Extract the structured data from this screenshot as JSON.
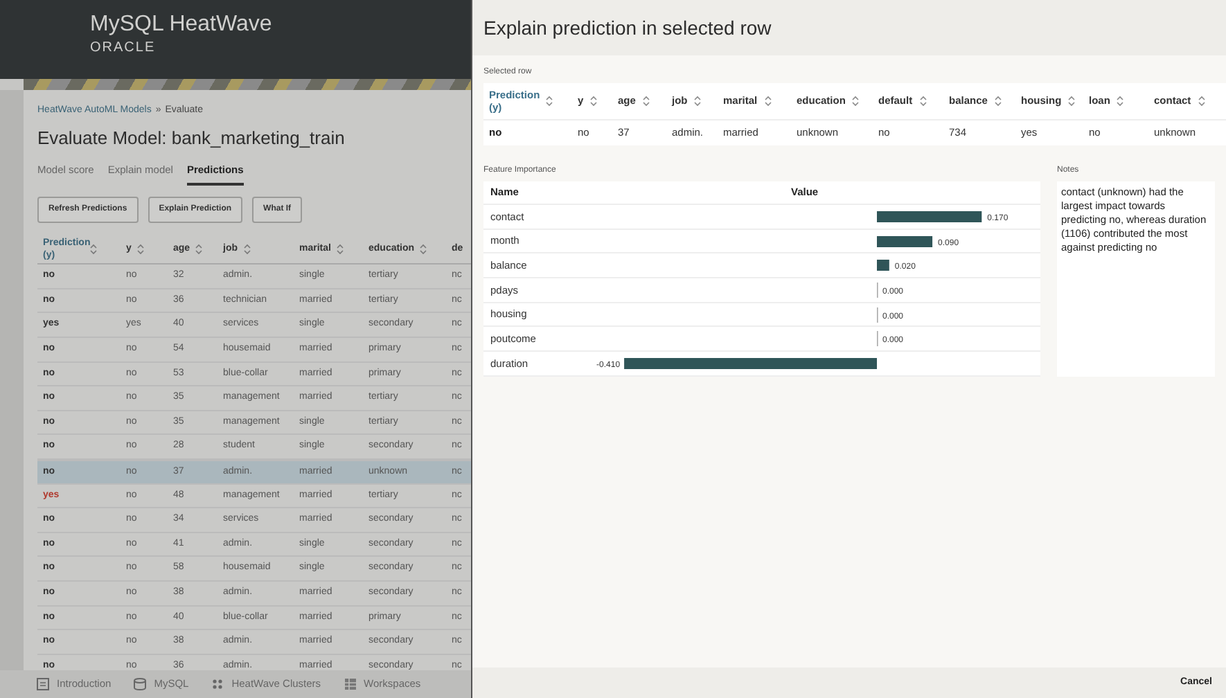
{
  "app": {
    "title": "MySQL HeatWave",
    "brand": "ORACLE"
  },
  "page": {
    "breadcrumb": [
      {
        "label": "HeatWave AutoML Models"
      },
      {
        "label": "Evaluate"
      }
    ],
    "breadcrumb_separator": "»",
    "title": "Evaluate Model: bank_marketing_train",
    "tabs": [
      {
        "label": "Model score",
        "selected": false
      },
      {
        "label": "Explain model",
        "selected": false
      },
      {
        "label": "Predictions",
        "selected": true
      }
    ],
    "buttons": [
      "Refresh Predictions",
      "Explain Prediction",
      "What If"
    ],
    "table": {
      "columns": [
        {
          "label": "Prediction (y)",
          "sortable": true
        },
        {
          "label": "y",
          "sortable": true
        },
        {
          "label": "age",
          "sortable": true
        },
        {
          "label": "job",
          "sortable": true
        },
        {
          "label": "marital",
          "sortable": true
        },
        {
          "label": "education",
          "sortable": true
        },
        {
          "label": "de",
          "sortable": false
        }
      ],
      "rows": [
        {
          "cells": [
            "no",
            "no",
            "32",
            "admin.",
            "single",
            "tertiary",
            "nc"
          ],
          "selected": false,
          "mismatch": false
        },
        {
          "cells": [
            "no",
            "no",
            "36",
            "technician",
            "married",
            "tertiary",
            "nc"
          ],
          "selected": false,
          "mismatch": false
        },
        {
          "cells": [
            "yes",
            "yes",
            "40",
            "services",
            "single",
            "secondary",
            "nc"
          ],
          "selected": false,
          "mismatch": false
        },
        {
          "cells": [
            "no",
            "no",
            "54",
            "housemaid",
            "married",
            "primary",
            "nc"
          ],
          "selected": false,
          "mismatch": false
        },
        {
          "cells": [
            "no",
            "no",
            "53",
            "blue-collar",
            "married",
            "primary",
            "nc"
          ],
          "selected": false,
          "mismatch": false
        },
        {
          "cells": [
            "no",
            "no",
            "35",
            "management",
            "married",
            "tertiary",
            "nc"
          ],
          "selected": false,
          "mismatch": false
        },
        {
          "cells": [
            "no",
            "no",
            "35",
            "management",
            "single",
            "tertiary",
            "nc"
          ],
          "selected": false,
          "mismatch": false
        },
        {
          "cells": [
            "no",
            "no",
            "28",
            "student",
            "single",
            "secondary",
            "nc"
          ],
          "selected": false,
          "mismatch": false
        },
        {
          "cells": [
            "no",
            "no",
            "37",
            "admin.",
            "married",
            "unknown",
            "nc"
          ],
          "selected": true,
          "mismatch": false
        },
        {
          "cells": [
            "yes",
            "no",
            "48",
            "management",
            "married",
            "tertiary",
            "nc"
          ],
          "selected": false,
          "mismatch": true
        },
        {
          "cells": [
            "no",
            "no",
            "34",
            "services",
            "married",
            "secondary",
            "nc"
          ],
          "selected": false,
          "mismatch": false
        },
        {
          "cells": [
            "no",
            "no",
            "41",
            "admin.",
            "single",
            "secondary",
            "nc"
          ],
          "selected": false,
          "mismatch": false
        },
        {
          "cells": [
            "no",
            "no",
            "58",
            "housemaid",
            "single",
            "secondary",
            "nc"
          ],
          "selected": false,
          "mismatch": false
        },
        {
          "cells": [
            "no",
            "no",
            "38",
            "admin.",
            "married",
            "secondary",
            "nc"
          ],
          "selected": false,
          "mismatch": false
        },
        {
          "cells": [
            "no",
            "no",
            "40",
            "blue-collar",
            "married",
            "primary",
            "nc"
          ],
          "selected": false,
          "mismatch": false
        },
        {
          "cells": [
            "no",
            "no",
            "38",
            "admin.",
            "married",
            "secondary",
            "nc"
          ],
          "selected": false,
          "mismatch": false
        },
        {
          "cells": [
            "no",
            "no",
            "36",
            "admin.",
            "married",
            "secondary",
            "nc"
          ],
          "selected": false,
          "mismatch": false
        }
      ]
    }
  },
  "bottom_nav": [
    {
      "label": "Introduction"
    },
    {
      "label": "MySQL"
    },
    {
      "label": "HeatWave Clusters"
    },
    {
      "label": "Workspaces"
    }
  ],
  "drawer": {
    "title": "Explain prediction in selected row",
    "selected_row": {
      "label": "Selected row",
      "columns": [
        "Prediction (y)",
        "y",
        "age",
        "job",
        "marital",
        "education",
        "default",
        "balance",
        "housing",
        "loan",
        "contact"
      ],
      "cells": [
        "no",
        "no",
        "37",
        "admin.",
        "married",
        "unknown",
        "no",
        "734",
        "yes",
        "no",
        "unknown"
      ]
    },
    "feature_importance": {
      "label": "Feature Importance",
      "columns": [
        "Name",
        "Value"
      ],
      "chart_data": {
        "type": "bar",
        "orientation": "horizontal",
        "categories": [
          "contact",
          "month",
          "balance",
          "pdays",
          "housing",
          "poutcome",
          "duration"
        ],
        "values": [
          0.17,
          0.09,
          0.02,
          0,
          0,
          0,
          -0.41
        ],
        "value_labels": [
          "0.170",
          "0.090",
          "0.020",
          "0.000",
          "0.000",
          "0.000",
          "-0.410"
        ]
      }
    },
    "notes": {
      "label": "Notes",
      "text": "contact (unknown) had the largest impact towards predicting no, whereas duration (1106) contributed the most against predicting no"
    },
    "footer": {
      "buttons": [
        "Cancel"
      ]
    }
  }
}
